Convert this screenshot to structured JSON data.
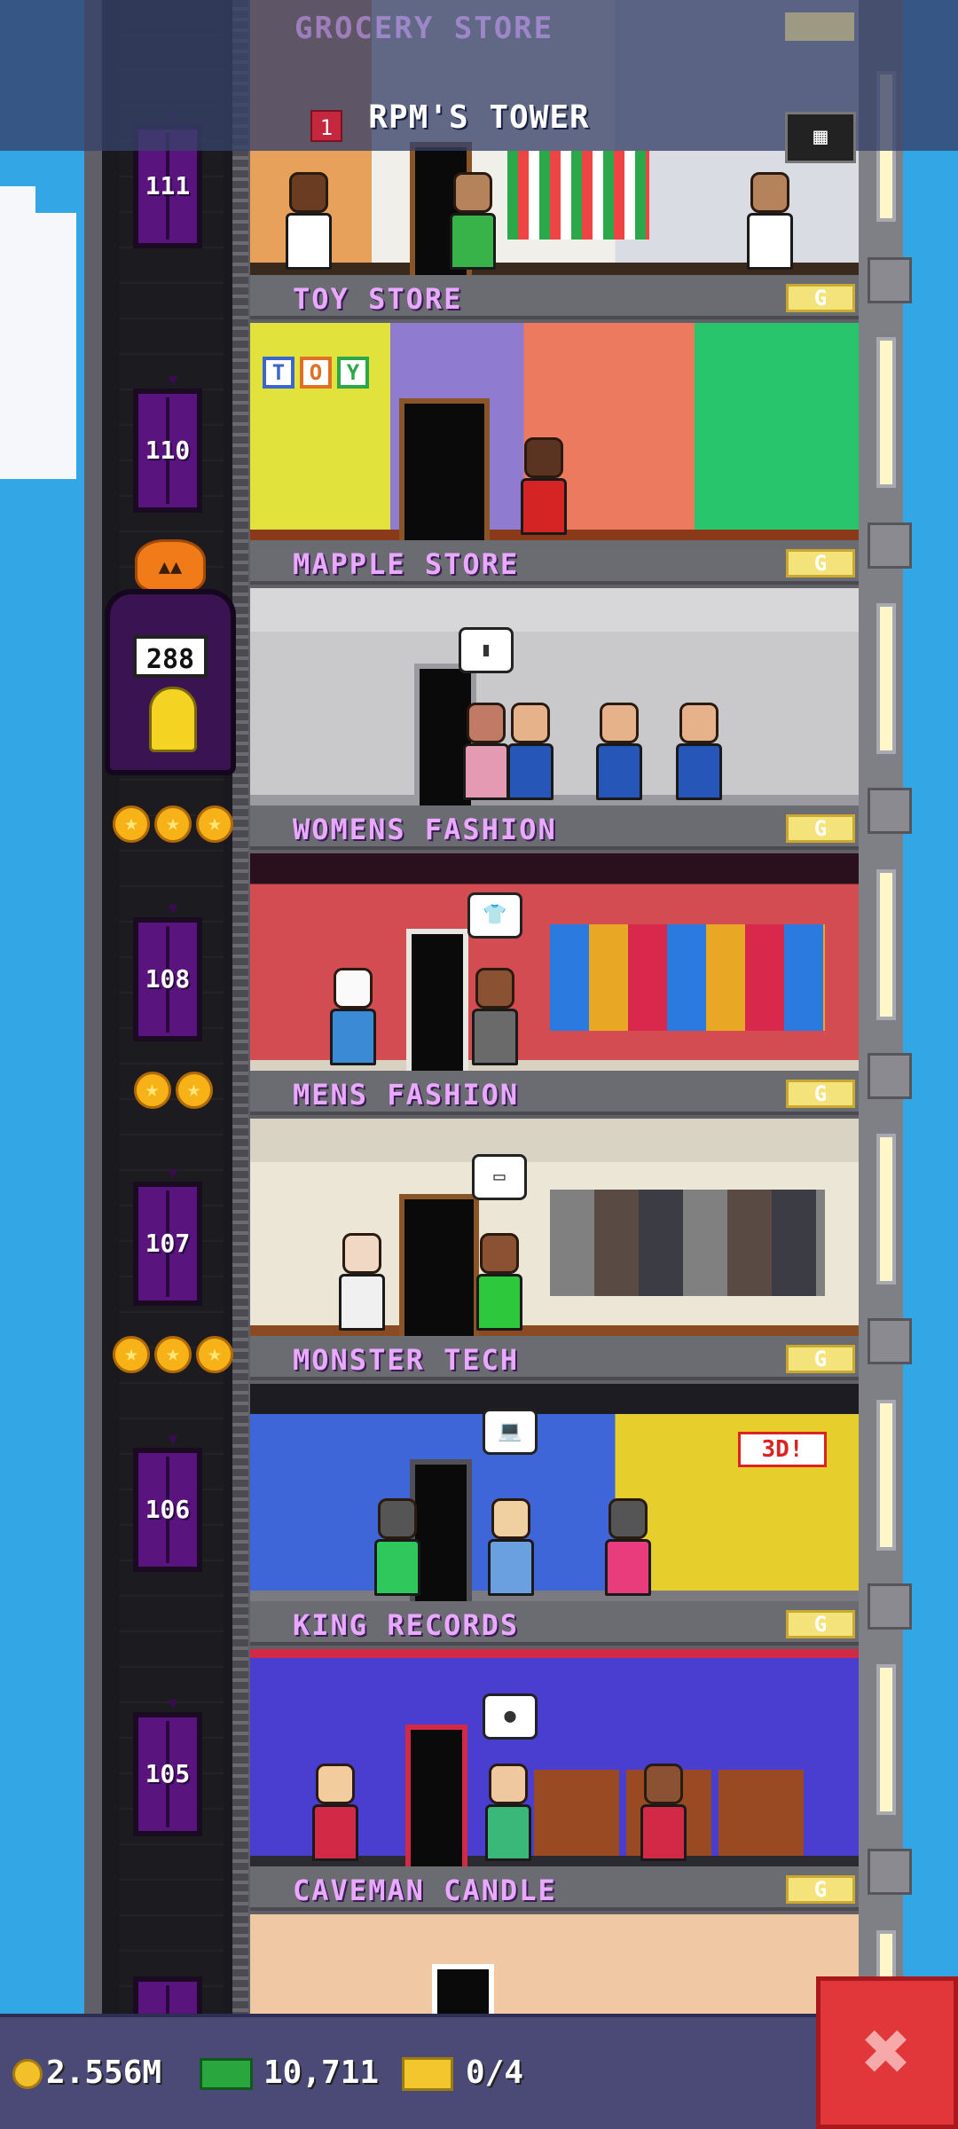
{
  "header": {
    "title": "RPM'S TOWER",
    "faded_floor_name": "GROCERY STORE",
    "faded_floor_badge": "G",
    "floor_num_icon": "1",
    "building_icon": "building-icon"
  },
  "elevator": {
    "floors": [
      {
        "label": "111"
      },
      {
        "label": "110"
      },
      {
        "label": "108"
      },
      {
        "label": "107"
      },
      {
        "label": "106"
      },
      {
        "label": "105"
      }
    ],
    "special_floor_count": "288"
  },
  "floors": [
    {
      "name": "TOY STORE",
      "badge": "G"
    },
    {
      "name": "MAPPLE STORE",
      "badge": "G"
    },
    {
      "name": "WOMENS FASHION",
      "badge": "G"
    },
    {
      "name": "MENS FASHION",
      "badge": "G"
    },
    {
      "name": "MONSTER TECH",
      "badge": "G",
      "sign": "3D!"
    },
    {
      "name": "KING RECORDS",
      "badge": "G"
    },
    {
      "name": "CAVEMAN CANDLE",
      "badge": "G"
    }
  ],
  "toy_store_sign": [
    "T",
    "O",
    "Y"
  ],
  "stars": {
    "mapple": 3,
    "womens": 2,
    "mens": 3
  },
  "status": {
    "coins": "2.556M",
    "bux": "10,711",
    "tickets": "0/4"
  },
  "close_label": "✖",
  "colors": {
    "sky": "#33a6e6",
    "floor_name": "#e9a9ff",
    "elevator": "#5a147e",
    "close_button": "#e2373a",
    "status_bar": "#4b4a76"
  }
}
